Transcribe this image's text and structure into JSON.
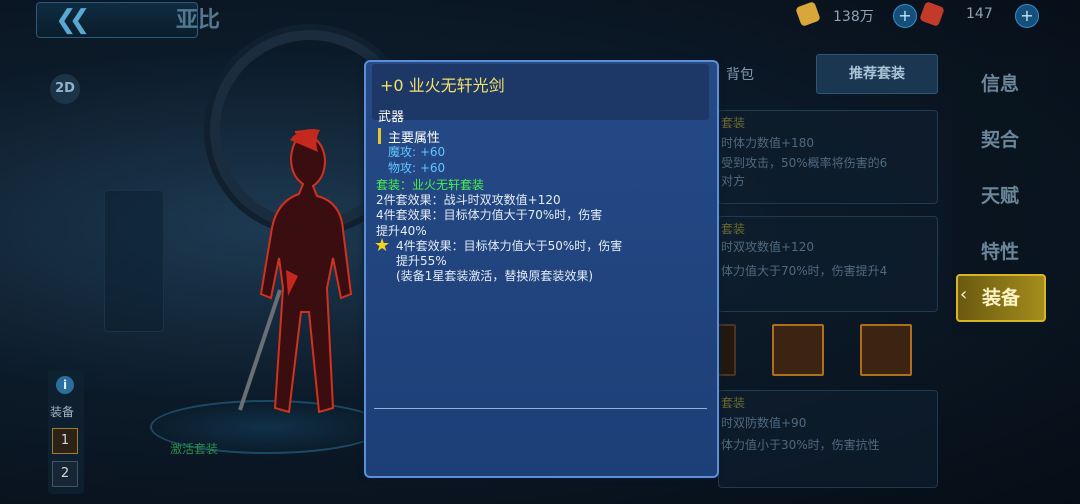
{
  "header": {
    "title": "亚比",
    "back_icon": "double-chevron-left-icon"
  },
  "resources": {
    "gold": "138万",
    "gems": "147"
  },
  "view_toggle": "2D",
  "equipment_panel": {
    "label": "装备",
    "slots": [
      "1",
      "2"
    ]
  },
  "platform_label": "激活套装",
  "tabs": {
    "bag": "背包",
    "recommended": "推荐套装"
  },
  "background_cards": [
    {
      "title": "套装",
      "line1": "时体力数值+180",
      "line2": "受到攻击，50%概率将伤害的6",
      "line3": "对方"
    },
    {
      "title": "套装",
      "line1": "时双攻数值+120",
      "line2": "体力值大于70%时，伤害提升4"
    },
    {
      "title": "套装",
      "line1": "时双防数值+90",
      "line2": "体力值小于30%时，伤害抗性"
    }
  ],
  "side_menu": [
    "信息",
    "契合",
    "天赋",
    "特性",
    "装备"
  ],
  "popup": {
    "item_name": "+0 业火无轩光剑",
    "item_type": "武器",
    "attr_title": "主要属性",
    "attr_magic": "魔攻: +60",
    "attr_phys": "物攻: +60",
    "set_name": "套装：业火无轩套装",
    "set2": "2件套效果：战斗时双攻数值+120",
    "set4_l1": "4件套效果：目标体力值大于70%时，伤害",
    "set4_l2": "提升40%",
    "star4_l1": "4件套效果：目标体力值大于50%时，伤害",
    "star4_l2": "提升55%",
    "star4_note": "(装备1星套装激活，替换原套装效果)"
  }
}
